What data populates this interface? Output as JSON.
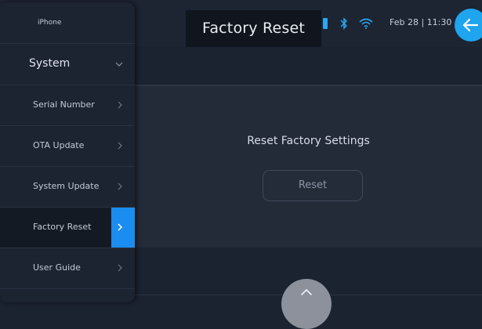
{
  "header": {
    "title": "Factory Reset",
    "date_time": "Feb 28 | 11:30",
    "icons": [
      "battery-icon",
      "bluetooth-icon",
      "wifi-icon"
    ],
    "back_icon": "arrow-left-icon"
  },
  "sidebar": {
    "device": "iPhone",
    "section": {
      "label": "System",
      "expanded": true
    },
    "items": [
      {
        "label": "Serial Number",
        "active": false
      },
      {
        "label": "OTA Update",
        "active": false
      },
      {
        "label": "System Update",
        "active": false
      },
      {
        "label": "Factory Reset",
        "active": true
      },
      {
        "label": "User Guide",
        "active": false
      }
    ]
  },
  "main": {
    "title": "Reset Factory Settings",
    "reset_label": "Reset"
  },
  "colors": {
    "accent": "#1b8df0",
    "back_button": "#1fa4ee",
    "background": "#1b2230",
    "panel": "#232a38"
  }
}
